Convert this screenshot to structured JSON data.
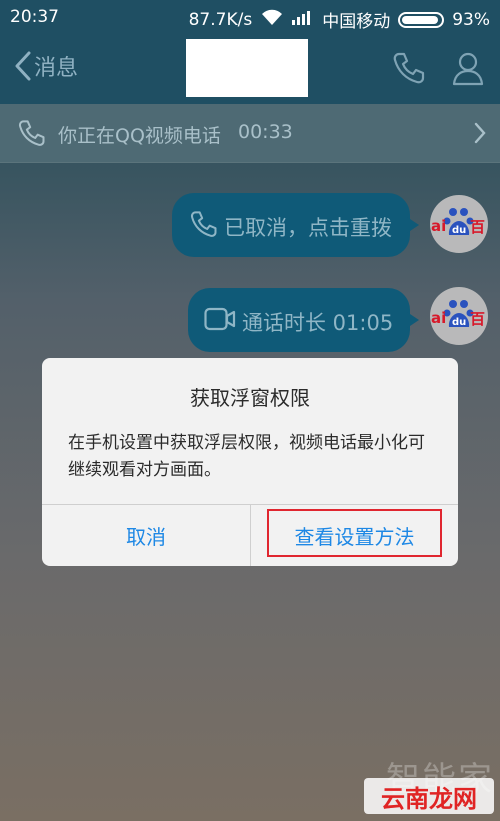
{
  "status_bar": {
    "time": "20:37",
    "speed": "87.7K/s",
    "carrier": "中国移动",
    "battery": "93%",
    "battery_level": 0.93
  },
  "header": {
    "back_label": "消息"
  },
  "call_banner": {
    "text": "你正在QQ视频电话",
    "duration": "00:33"
  },
  "messages": [
    {
      "text": "已取消，点击重拨",
      "icon": "phone-icon"
    },
    {
      "text": "通话时长 01:05",
      "icon": "video-camera-icon"
    }
  ],
  "avatar_label": {
    "left": "ai",
    "center": "du",
    "right": "百"
  },
  "dialog": {
    "title": "获取浮窗权限",
    "message": "在手机设置中获取浮层权限，视频电话最小化可继续观看对方画面。",
    "cancel_label": "取消",
    "confirm_label": "查看设置方法"
  },
  "watermark": {
    "top": "智能家",
    "bottom": "云南龙网"
  },
  "colors": {
    "header_bg": "#1f4f63",
    "bubble_bg": "#0f5a78",
    "dialog_button": "#1e88e5",
    "highlight": "#e0262f"
  }
}
